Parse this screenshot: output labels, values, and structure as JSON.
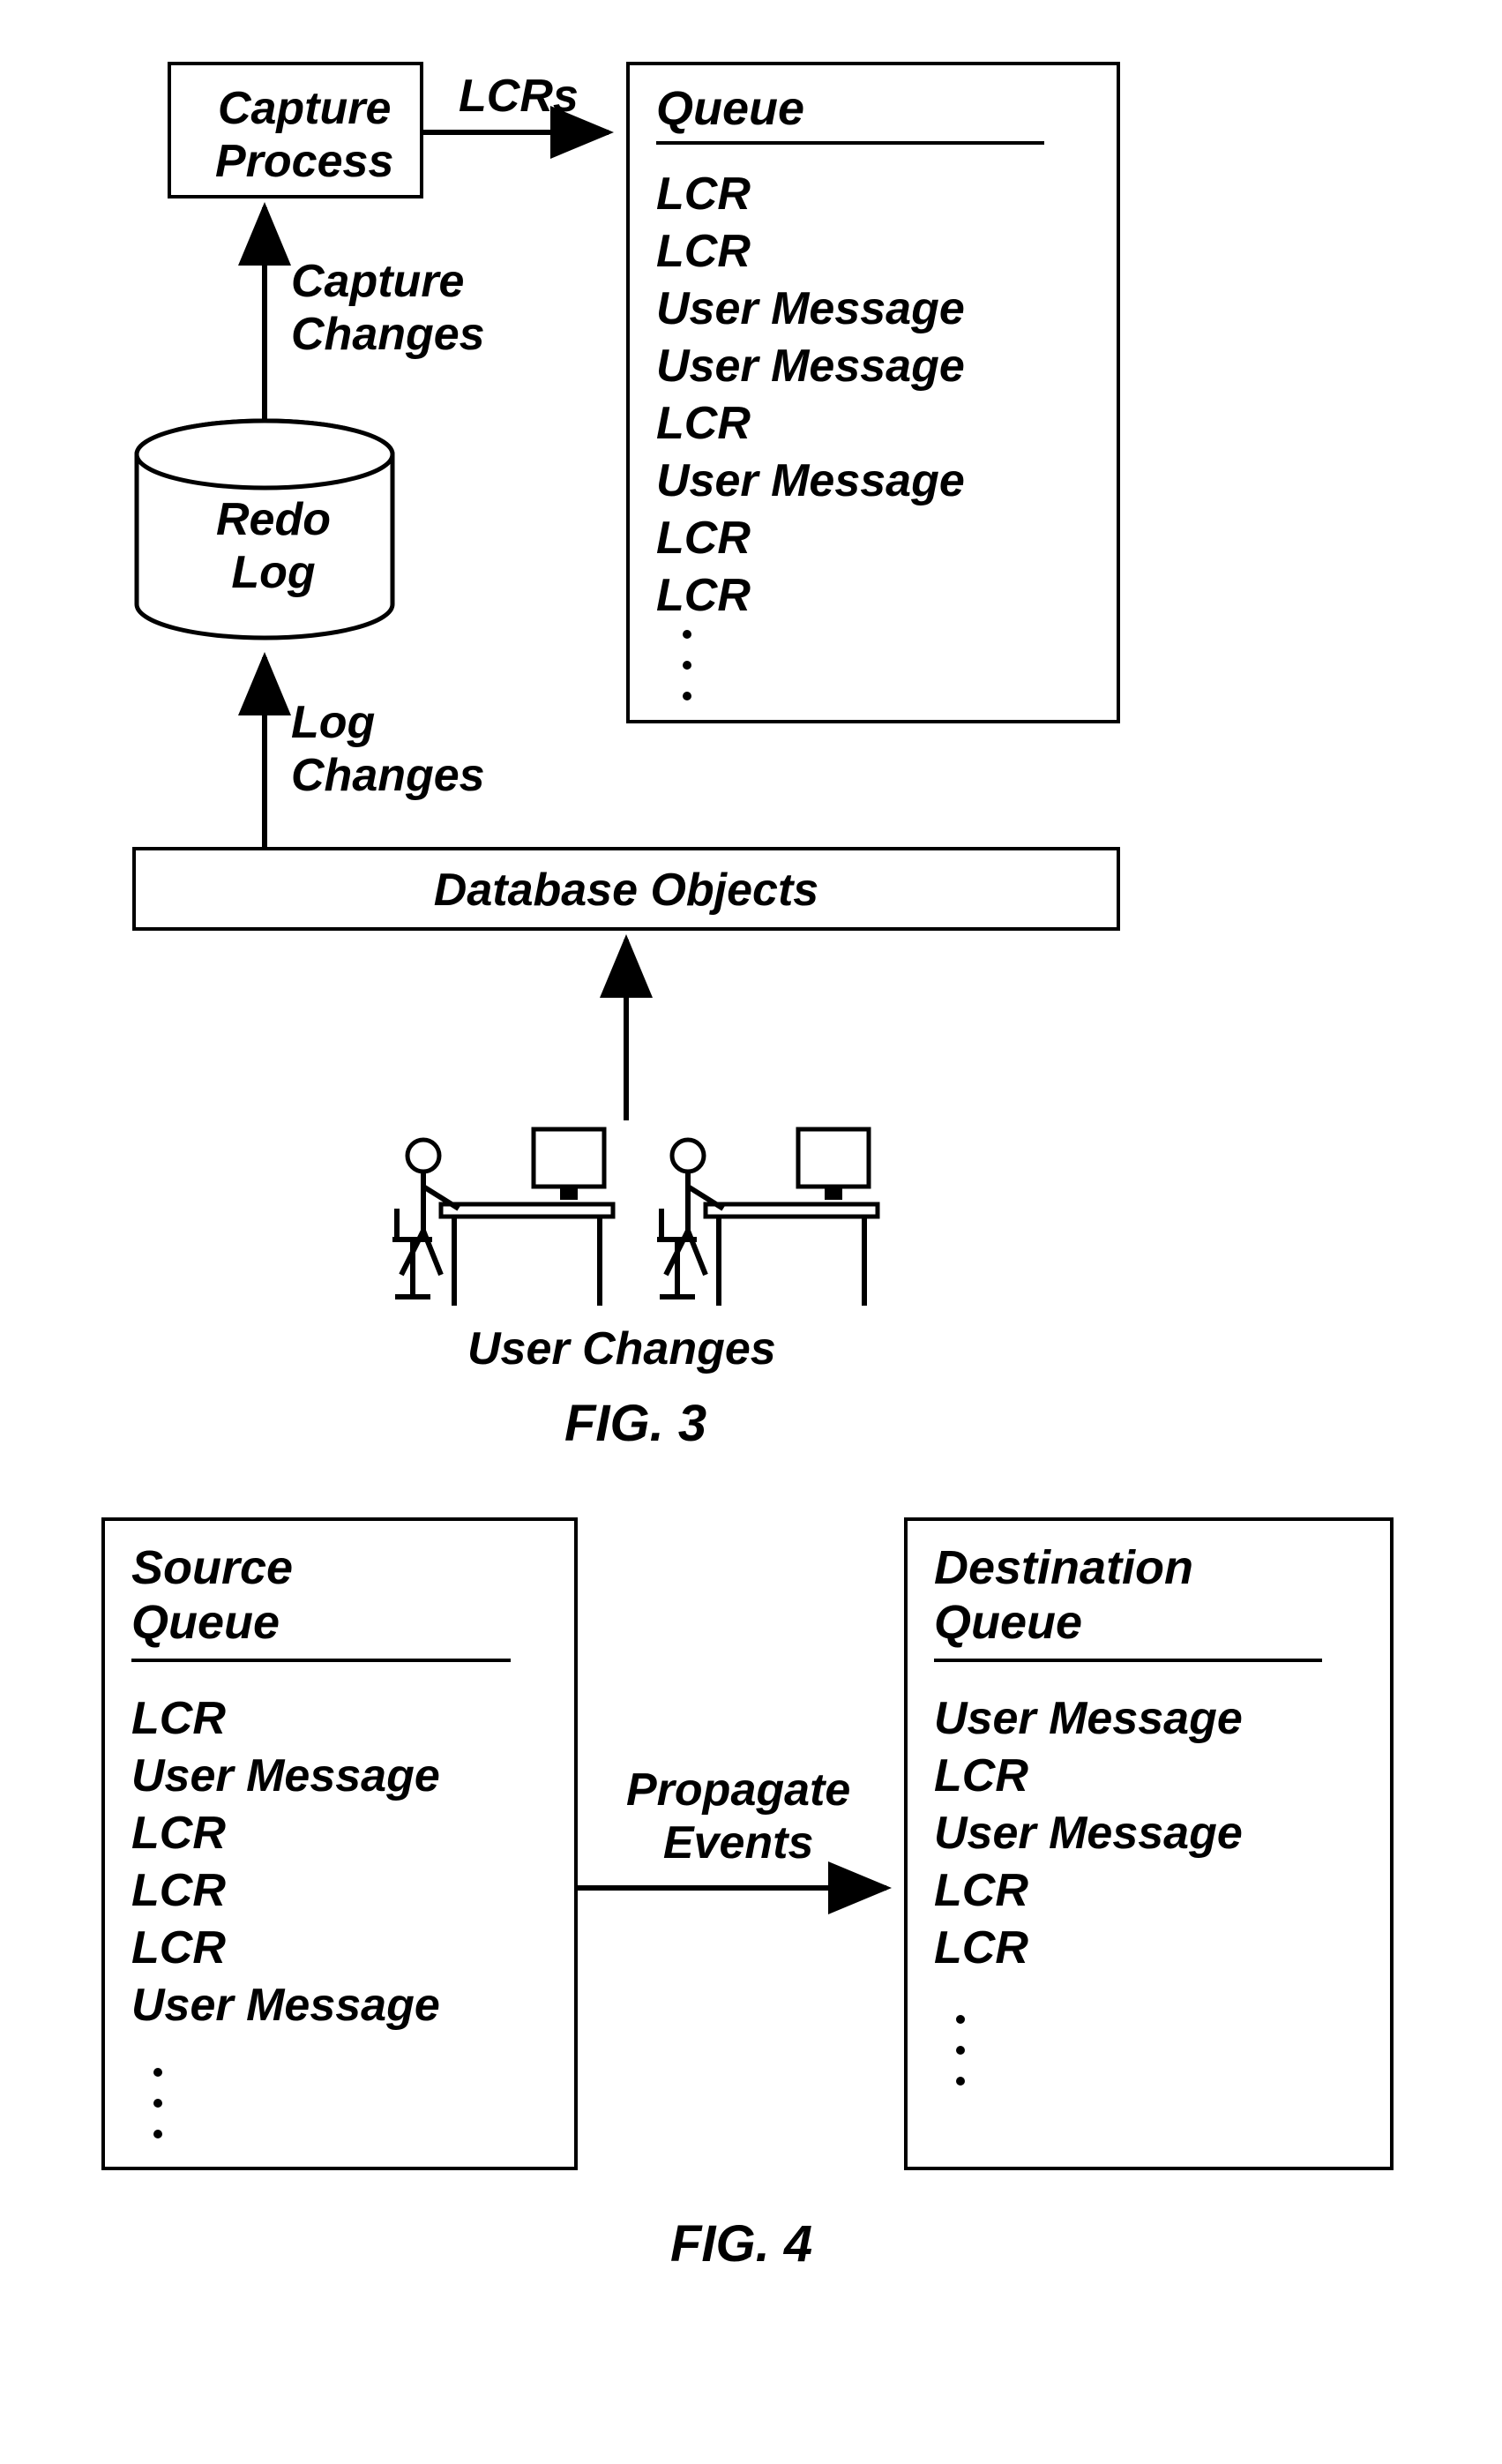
{
  "fig3": {
    "capture_process": "Capture\nProcess",
    "lcrs_label": "LCRs",
    "capture_changes": "Capture\nChanges",
    "redo_log": "Redo\nLog",
    "log_changes": "Log\nChanges",
    "database_objects": "Database Objects",
    "user_changes": "User Changes",
    "queue_title": "Queue",
    "queue_items": [
      "LCR",
      "LCR",
      "User Message",
      "User Message",
      "LCR",
      "User Message",
      "LCR",
      "LCR"
    ],
    "caption": "FIG. 3"
  },
  "fig4": {
    "source_title": "Source\nQueue",
    "source_items": [
      "LCR",
      "User Message",
      "LCR",
      "LCR",
      "LCR",
      "User Message"
    ],
    "propagate_events": "Propagate\nEvents",
    "dest_title": "Destination\nQueue",
    "dest_items": [
      "User Message",
      "LCR",
      "User Message",
      "LCR",
      "LCR"
    ],
    "caption": "FIG. 4"
  }
}
